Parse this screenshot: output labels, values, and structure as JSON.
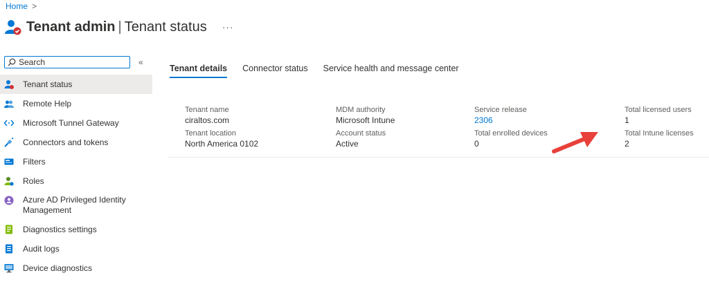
{
  "breadcrumb": {
    "home": "Home",
    "separator": ">"
  },
  "header": {
    "title_bold": "Tenant admin",
    "title_sep": "|",
    "title_rest": "Tenant status",
    "more": "···"
  },
  "search": {
    "placeholder": "Search",
    "collapse": "«"
  },
  "sidebar": {
    "items": [
      {
        "label": "Tenant status",
        "icon": "tenant-status-icon"
      },
      {
        "label": "Remote Help",
        "icon": "remote-help-icon"
      },
      {
        "label": "Microsoft Tunnel Gateway",
        "icon": "tunnel-gateway-icon"
      },
      {
        "label": "Connectors and tokens",
        "icon": "connectors-icon"
      },
      {
        "label": "Filters",
        "icon": "filters-icon"
      },
      {
        "label": "Roles",
        "icon": "roles-icon"
      },
      {
        "label": "Azure AD Privileged Identity Management",
        "icon": "pim-icon"
      },
      {
        "label": "Diagnostics settings",
        "icon": "diagnostics-settings-icon"
      },
      {
        "label": "Audit logs",
        "icon": "audit-logs-icon"
      },
      {
        "label": "Device diagnostics",
        "icon": "device-diagnostics-icon"
      }
    ]
  },
  "tabs": [
    {
      "label": "Tenant details",
      "active": true
    },
    {
      "label": "Connector status",
      "active": false
    },
    {
      "label": "Service health and message center",
      "active": false
    }
  ],
  "details": {
    "tenant_name": {
      "label": "Tenant name",
      "value": "ciraltos.com"
    },
    "tenant_location": {
      "label": "Tenant location",
      "value": "North America 0102"
    },
    "mdm_authority": {
      "label": "MDM authority",
      "value": "Microsoft Intune"
    },
    "account_status": {
      "label": "Account status",
      "value": "Active"
    },
    "service_release": {
      "label": "Service release",
      "value": "2306"
    },
    "enrolled_devices": {
      "label": "Total enrolled devices",
      "value": "0"
    },
    "licensed_users": {
      "label": "Total licensed users",
      "value": "1"
    },
    "intune_licenses": {
      "label": "Total Intune licenses",
      "value": "2"
    }
  },
  "colors": {
    "accent": "#0078d4",
    "arrow": "#e8403a",
    "active_nav_bg": "#edebe9"
  }
}
